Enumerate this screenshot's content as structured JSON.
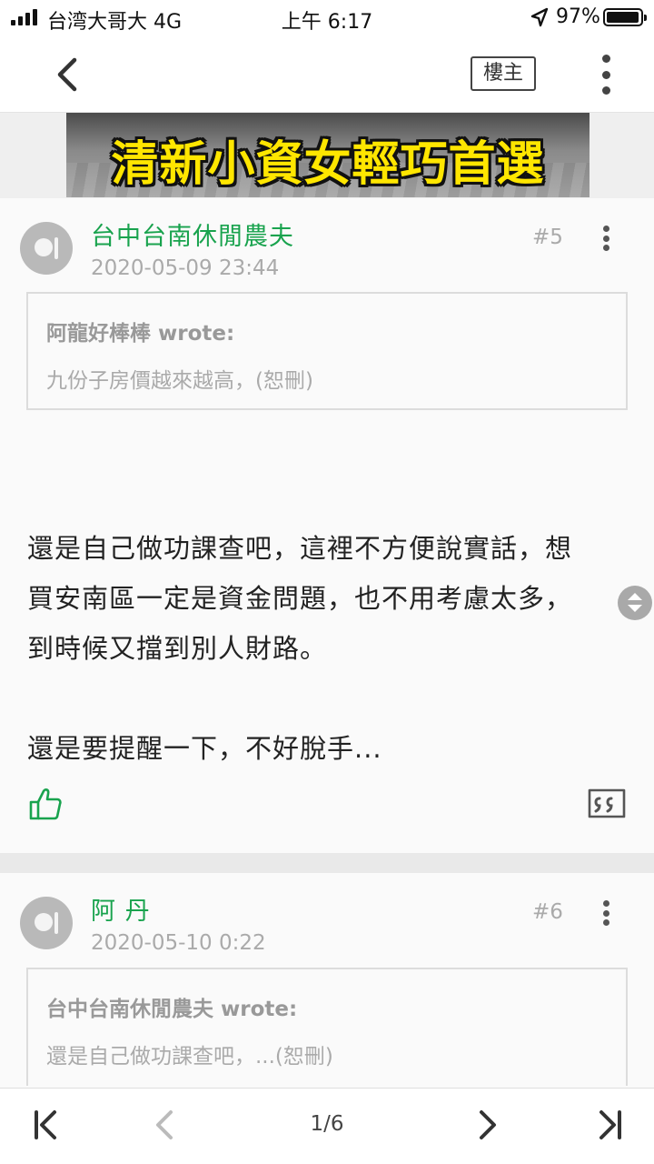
{
  "status_bar": {
    "carrier": "台湾大哥大 4G",
    "time": "上午 6:17",
    "battery": "97%",
    "battery_level": 0.97
  },
  "nav": {
    "op_label": "樓主"
  },
  "ad": {
    "text": "清新小資女輕巧首選"
  },
  "posts": [
    {
      "author": "台中台南休閒農夫",
      "date": "2020-05-09 23:44",
      "floor": "#5",
      "quote": {
        "author": "阿龍好棒棒 wrote:",
        "text": "九份子房價越來越高，(恕刪)"
      },
      "body": [
        "還是自己做功課查吧，這裡不方便說實話，想",
        "買安南區一定是資金問題，也不用考慮太多，",
        "到時候又擋到別人財路。",
        "",
        "還是要提醒一下，不好脫手..."
      ]
    },
    {
      "author": "阿 丹",
      "date": "2020-05-10 0:22",
      "floor": "#6",
      "quote": {
        "author": "台中台南休閒農夫 wrote:",
        "text": "還是自己做功課查吧，...(恕刪)"
      }
    }
  ],
  "pagination": {
    "label": "1/6",
    "current": 1,
    "total": 6
  },
  "colors": {
    "accent_green": "#19a34e",
    "ad_text_yellow": "#ffe600"
  },
  "icons": [
    "back-icon",
    "more-vertical-icon",
    "location-arrow-icon",
    "battery-icon",
    "thumbs-up-icon",
    "quote-reply-icon",
    "first-page-icon",
    "prev-page-icon",
    "next-page-icon",
    "last-page-icon"
  ]
}
